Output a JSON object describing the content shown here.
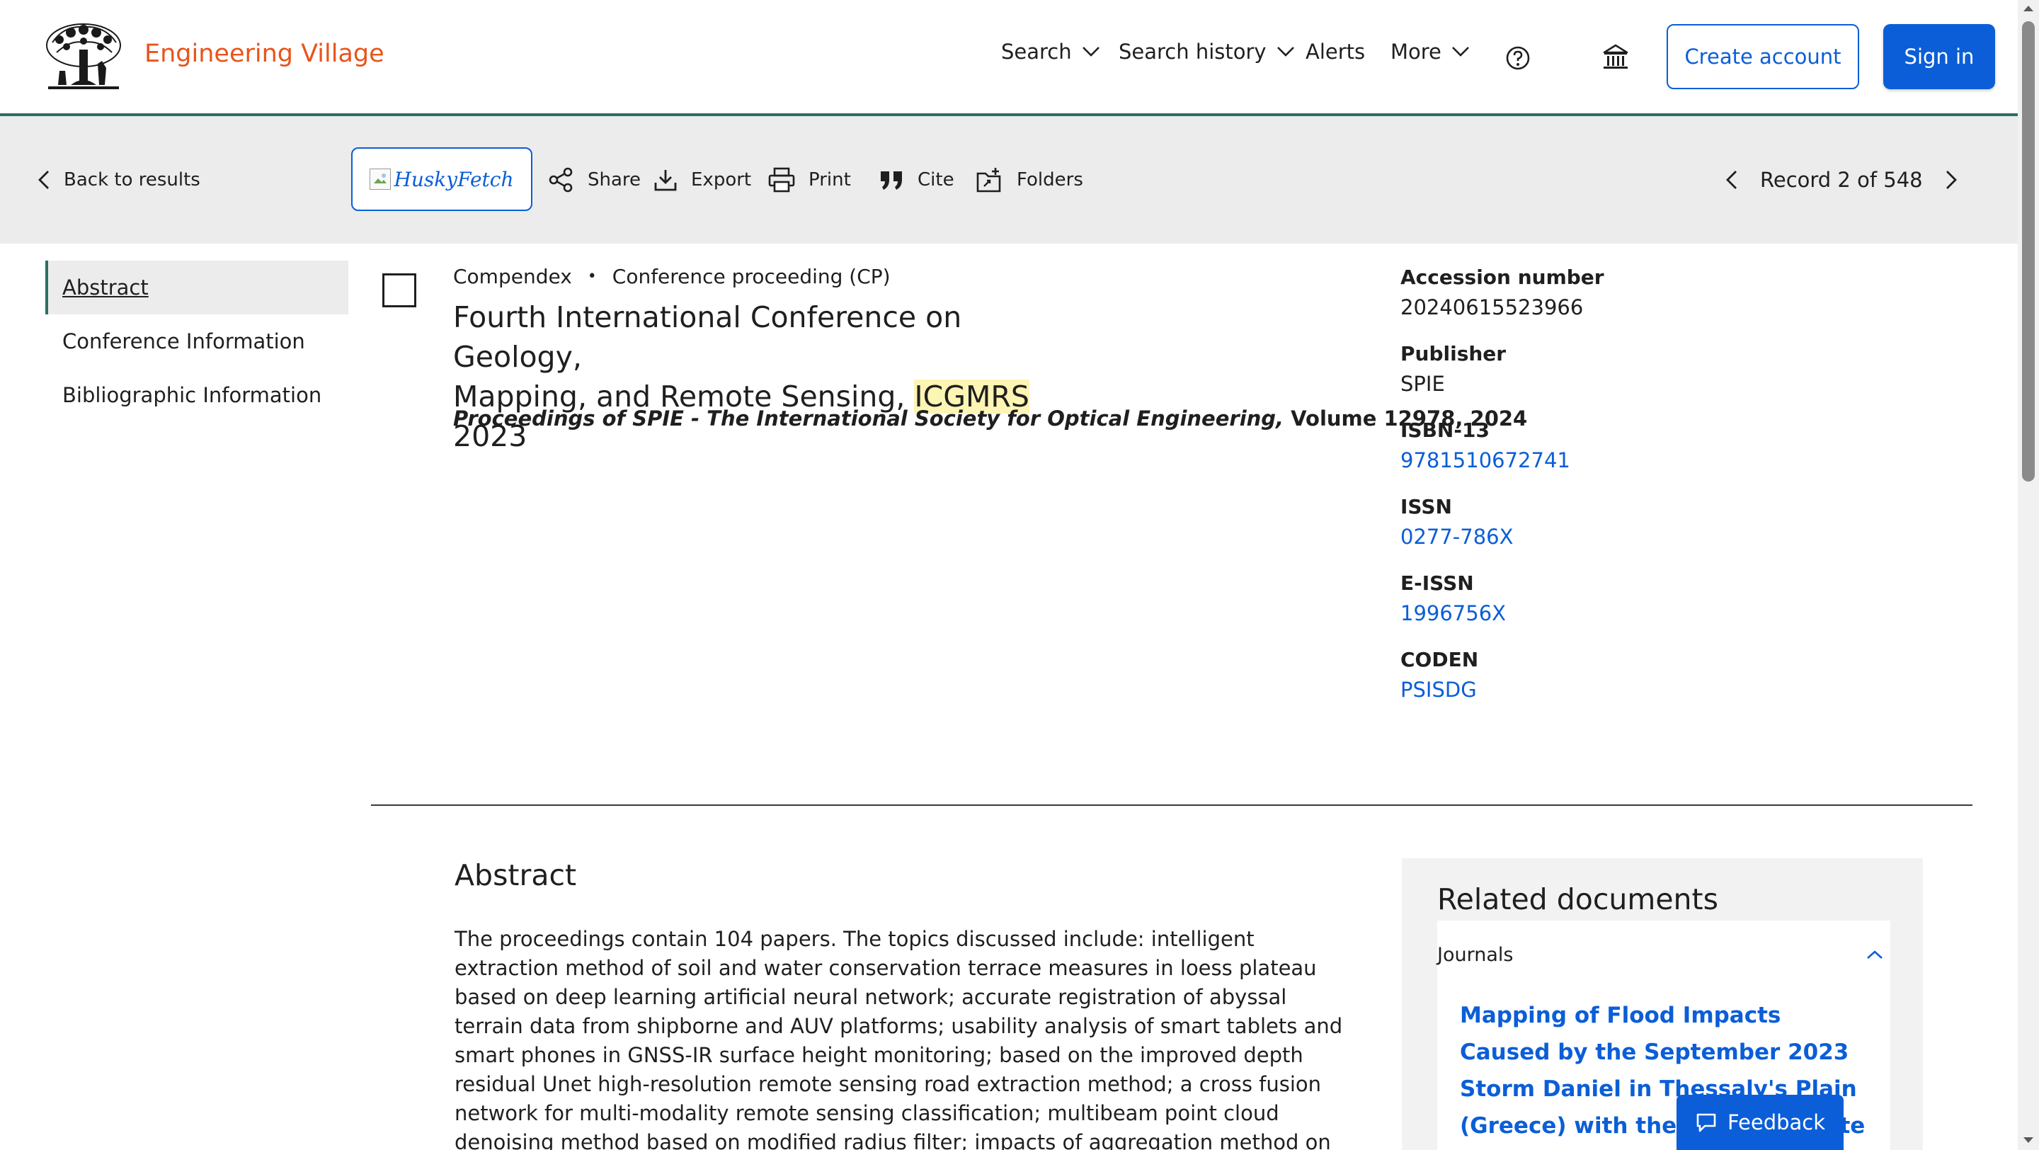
{
  "colors": {
    "brand_orange": "#e9541a",
    "primary_blue": "#0b5ed7",
    "accent_green": "#2c6e63",
    "toolbar_gray": "#ececec",
    "highlight_yellow": "#fdf5b4"
  },
  "header": {
    "brand": "Engineering Village",
    "logo_icon": "elsevier-tree-logo",
    "nav": {
      "search": "Search",
      "search_history": "Search history",
      "alerts": "Alerts",
      "more": "More"
    },
    "help_icon": "help-circle-icon",
    "institution_icon": "institution-icon",
    "create_account": "Create account",
    "sign_in": "Sign in"
  },
  "toolbar": {
    "back": "Back to results",
    "huskyfetch": "HuskyFetch",
    "share": "Share",
    "export": "Export",
    "print": "Print",
    "cite": "Cite",
    "folders": "Folders",
    "record": "Record 2 of 548"
  },
  "sidebar": {
    "items": [
      {
        "label": "Abstract",
        "active": true
      },
      {
        "label": "Conference Information",
        "active": false
      },
      {
        "label": "Bibliographic Information",
        "active": false
      }
    ]
  },
  "record": {
    "database": "Compendex",
    "separator": "•",
    "doc_type": "Conference proceeding (CP)",
    "title_part1": "Fourth International Conference on Geology,",
    "title_part2": "Mapping, and Remote Sensing, ",
    "title_highlight": "ICGMRS",
    "title_part3": " 2023",
    "source_title": "Proceedings of SPIE - The International Society for Optical Engineering,",
    "source_rest": " Volume 12978, 2024"
  },
  "metadata": {
    "accession_label": "Accession number",
    "accession_value": "20240615523966",
    "publisher_label": "Publisher",
    "publisher_value": "SPIE",
    "isbn_label": "ISBN-13",
    "isbn_value": "9781510672741",
    "issn_label": "ISSN",
    "issn_value": "0277-786X",
    "eissn_label": "E-ISSN",
    "eissn_value": "1996756X",
    "coden_label": "CODEN",
    "coden_value": "PSISDG"
  },
  "abstract": {
    "heading": "Abstract",
    "text": "The proceedings contain 104 papers. The topics discussed include: intelligent extraction method of soil and water conservation terrace measures in loess plateau based on deep learning artificial neural network; accurate registration of abyssal terrain data from shipborne and AUV platforms; usability analysis of smart tablets and smart phones in GNSS-IR surface height monitoring; based on the improved depth residual Unet high-resolution remote sensing road extraction method; a cross fusion network for multi-modality remote sensing classification; multibeam point cloud denoising method based on modified radius filter; impacts of aggregation method on the simulation of multispectral broadband reflectance;"
  },
  "related": {
    "heading": "Related documents",
    "category": "Journals",
    "link": "Mapping of Flood Impacts Caused by the September 2023 Storm Daniel in Thessaly's Plain (Greece) with the Use of Remote Sensing Satellite Data"
  },
  "feedback": {
    "label": "Feedback"
  }
}
